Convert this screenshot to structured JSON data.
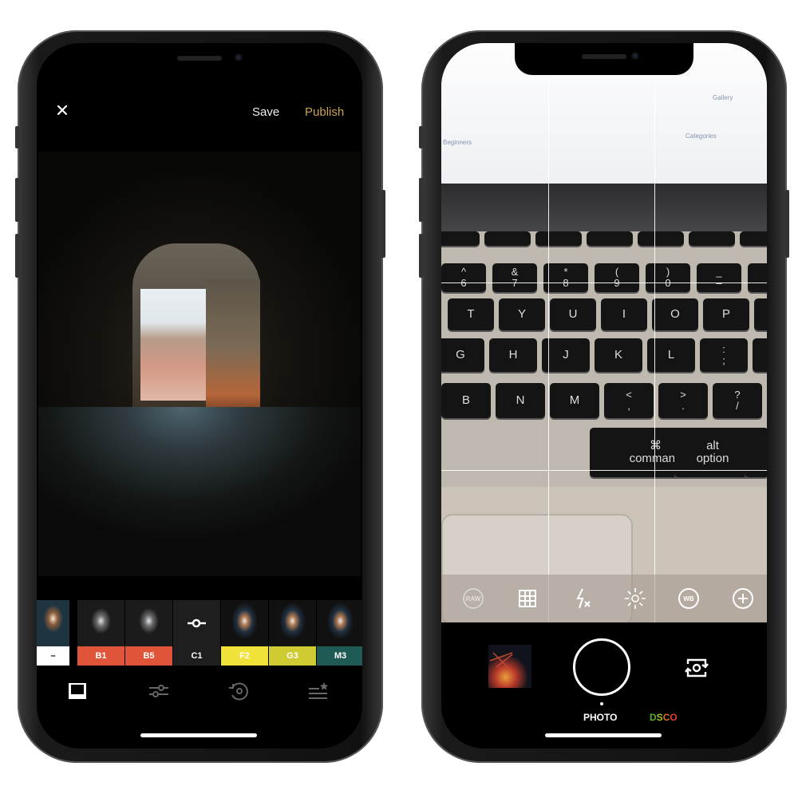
{
  "editor": {
    "close_icon": "close-icon",
    "save_label": "Save",
    "publish_label": "Publish",
    "publish_color": "#c9a44a",
    "filters": [
      {
        "label": "–",
        "color": "#ffffff",
        "text_color": "#000000"
      },
      {
        "label": "B1",
        "color": "#e0553a",
        "text_color": "#ffffff"
      },
      {
        "label": "B5",
        "color": "#e0553a",
        "text_color": "#ffffff"
      },
      {
        "label": "C1",
        "color": "#1e1e1e",
        "text_color": "#ffffff",
        "selected": true
      },
      {
        "label": "F2",
        "color": "#f1e23a",
        "text_color": "#ffffff"
      },
      {
        "label": "G3",
        "color": "#cfcb33",
        "text_color": "#ffffff"
      },
      {
        "label": "M3",
        "color": "#1f5a55",
        "text_color": "#ffffff"
      }
    ],
    "tabs": [
      "presets-icon",
      "adjust-sliders-icon",
      "history-icon",
      "recipes-icon"
    ],
    "active_tab": "presets-icon"
  },
  "camera": {
    "screen_text": [
      "Gallery",
      "Categories",
      "Beginners"
    ],
    "keyboard_rows": [
      [
        "",
        "",
        "",
        "",
        "",
        "",
        "",
        ""
      ],
      [
        "^ 6",
        "& 7",
        "* 8",
        "( 9",
        ") 0",
        "_ –",
        ""
      ],
      [
        "T",
        "Y",
        "U",
        "I",
        "O",
        "P",
        "{ ["
      ],
      [
        "G",
        "H",
        "J",
        "K",
        "L",
        ": ;",
        ""
      ],
      [
        "B",
        "N",
        "M",
        "< ,",
        "> .",
        "? /"
      ],
      [
        "⌘ command",
        "alt option",
        ""
      ]
    ],
    "tools": [
      "RAW",
      "grid-icon",
      "flash-off-icon",
      "exposure-icon",
      "WB",
      "plus-icon"
    ],
    "modes": [
      "PHOTO",
      "DSCO"
    ],
    "active_mode": "PHOTO",
    "dsco_colors": [
      "#58b026",
      "#a8c224",
      "#e0701f",
      "#e0402a"
    ]
  }
}
